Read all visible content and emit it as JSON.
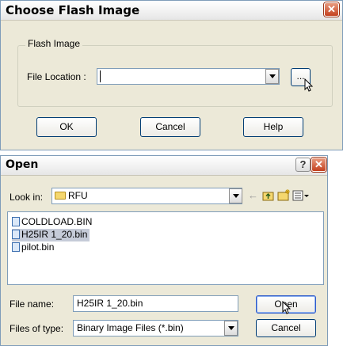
{
  "flash_dialog": {
    "title": "Choose Flash Image",
    "group_label": "Flash Image",
    "file_location_label": "File Location :",
    "file_location_value": "",
    "browse_label": "...",
    "ok_label": "OK",
    "cancel_label": "Cancel",
    "help_label": "Help"
  },
  "open_dialog": {
    "title": "Open",
    "help_glyph": "?",
    "look_in_label": "Look in:",
    "look_in_value": "RFU",
    "files": [
      "COLDLOAD.BIN",
      "H25IR 1_20.bin",
      "pilot.bin"
    ],
    "selected_file": "H25IR 1_20.bin",
    "file_name_label": "File name:",
    "file_name_value": "H25IR 1_20.bin",
    "files_of_type_label": "Files of type:",
    "files_of_type_value": "Binary Image Files (*.bin)",
    "open_label": "Open",
    "cancel_label": "Cancel"
  },
  "close_glyph": "✕",
  "icons": [
    "close-icon",
    "help-icon",
    "folder-icon",
    "back-arrow-icon",
    "up-folder-icon",
    "new-folder-icon",
    "view-menu-icon",
    "file-icon",
    "mouse-cursor-icon"
  ]
}
